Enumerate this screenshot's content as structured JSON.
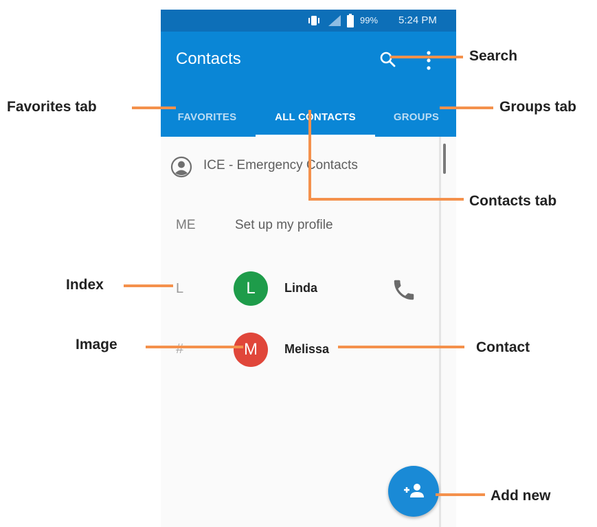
{
  "status_bar": {
    "battery": "99%",
    "time": "5:24 PM"
  },
  "toolbar": {
    "title": "Contacts"
  },
  "tabs": [
    {
      "label": "FAVORITES",
      "active": false
    },
    {
      "label": "ALL CONTACTS",
      "active": true
    },
    {
      "label": "GROUPS",
      "active": false
    }
  ],
  "list": {
    "ice": {
      "label": "ICE - Emergency Contacts"
    },
    "me": {
      "index": "ME",
      "label": "Set up my profile"
    },
    "contacts": [
      {
        "index": "L",
        "initial": "L",
        "name": "Linda",
        "avatar_color": "#1e9c4a"
      },
      {
        "index": "#",
        "initial": "M",
        "name": "Melissa",
        "avatar_color": "#e0463a"
      }
    ]
  },
  "annotations": {
    "search": "Search",
    "favorites_tab": "Favorites tab",
    "groups_tab": "Groups tab",
    "contacts_tab": "Contacts tab",
    "index": "Index",
    "image": "Image",
    "contact": "Contact",
    "add_new": "Add new"
  },
  "colors": {
    "status_bar": "#0d6fb8",
    "toolbar": "#0a86d6",
    "fab": "#1a8ad6",
    "annotation_line": "#f4914c"
  }
}
